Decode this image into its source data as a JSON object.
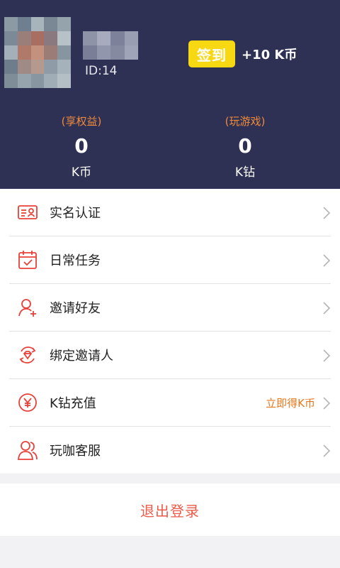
{
  "profile": {
    "user_id": "ID:14"
  },
  "signin": {
    "button_label": "签到",
    "reward": "+10 K币"
  },
  "stats": [
    {
      "tag": "(享权益)",
      "value": "0",
      "unit": "K币"
    },
    {
      "tag": "(玩游戏)",
      "value": "0",
      "unit": "K钻"
    }
  ],
  "menu": [
    {
      "label": "实名认证",
      "icon": "id-card-icon",
      "hint": ""
    },
    {
      "label": "日常任务",
      "icon": "calendar-check-icon",
      "hint": ""
    },
    {
      "label": "邀请好友",
      "icon": "add-user-icon",
      "hint": ""
    },
    {
      "label": "绑定邀请人",
      "icon": "diamond-link-icon",
      "hint": ""
    },
    {
      "label": "K钻充值",
      "icon": "yuan-coin-icon",
      "hint": "立即得K币"
    },
    {
      "label": "玩咖客服",
      "icon": "customer-service-icon",
      "hint": ""
    }
  ],
  "logout_label": "退出登录",
  "colors": {
    "header_bg": "#2e3153",
    "accent_red": "#e9403a",
    "hint_orange": "#e8761c",
    "signin_yellow": "#f7d813"
  }
}
